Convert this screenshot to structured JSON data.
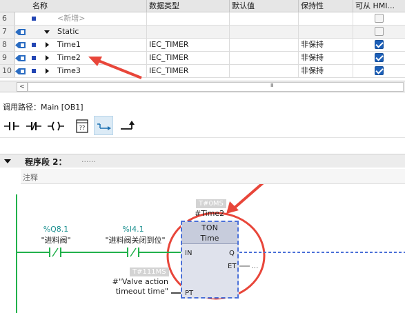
{
  "table": {
    "headers": [
      "名称",
      "数据类型",
      "默认值",
      "保持性",
      "可从 HMI..."
    ],
    "rows": [
      {
        "num": "6",
        "name": "<新增>",
        "type": "",
        "default": "",
        "retain": "",
        "hmi": false
      },
      {
        "num": "7",
        "name": "Static",
        "type": "",
        "default": "",
        "retain": "",
        "hmi": false
      },
      {
        "num": "8",
        "name": "Time1",
        "type": "IEC_TIMER",
        "default": "",
        "retain": "非保持",
        "hmi": true
      },
      {
        "num": "9",
        "name": "Time2",
        "type": "IEC_TIMER",
        "default": "",
        "retain": "非保持",
        "hmi": true
      },
      {
        "num": "10",
        "name": "Time3",
        "type": "IEC_TIMER",
        "default": "",
        "retain": "非保持",
        "hmi": true
      }
    ],
    "scroll_left": "<",
    "scroll_grip": "III"
  },
  "callpath": "调用路径：Main [OB1]",
  "toolbar": {
    "icons": [
      "no-contact-icon",
      "nc-contact-icon",
      "coil-icon",
      "empty-box-icon",
      "open-branch-icon",
      "close-branch-icon"
    ],
    "box_label": "??"
  },
  "network": {
    "title": "程序段 2：",
    "dots": "......",
    "comment": "注释"
  },
  "ladder": {
    "contact1": {
      "addr": "%Q8.1",
      "name": "\"进料阀\""
    },
    "contact2": {
      "addr": "%I4.1",
      "name": "\"进料阀关闭到位\""
    },
    "fb": {
      "time_tag": "T#0MS",
      "instance": "#Time2",
      "type": "TON",
      "subtype": "Time",
      "pin_in": "IN",
      "pin_q": "Q",
      "pin_et": "ET",
      "pin_pt": "PT",
      "et_value": "...",
      "pt_tag": "T#111MS",
      "pt_name_1": "#\"Valve action",
      "pt_name_2": "timeout time\""
    }
  },
  "colors": {
    "accent_blue": "#4a70d8",
    "annotation_red": "#e8463a",
    "address_teal": "#1b8f8f",
    "contact_green": "#22b14c"
  }
}
